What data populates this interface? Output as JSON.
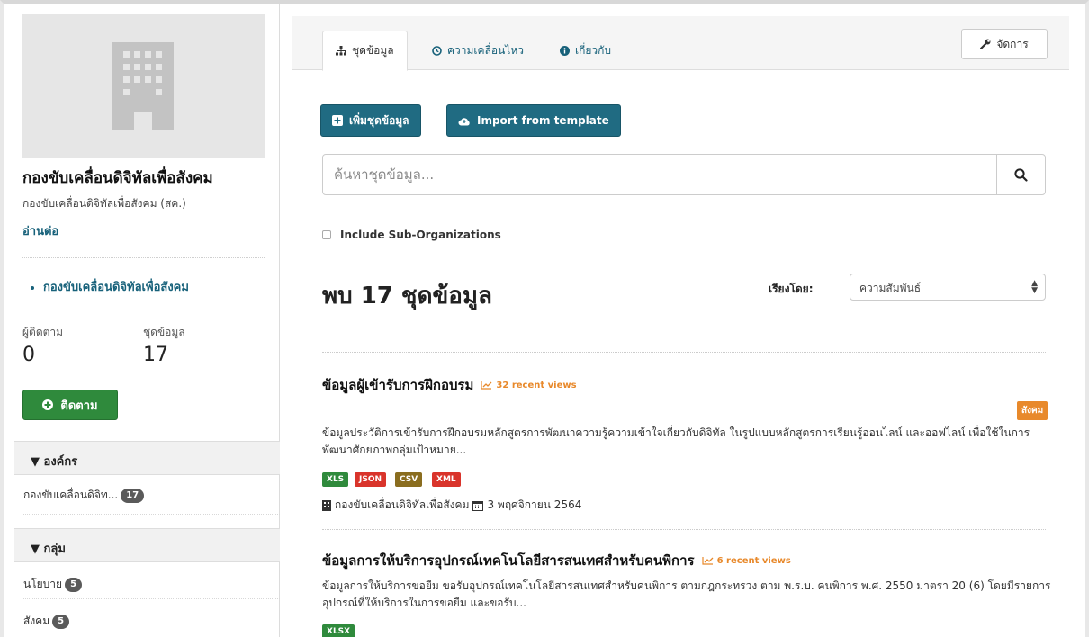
{
  "sidebar": {
    "org_title": "กองขับเคลื่อนดิจิทัลเพื่อสังคม",
    "org_subtitle": "กองขับเคลื่อนดิจิทัลเพื่อสังคม (สค.)",
    "read_more": "อ่านต่อ",
    "org_link": "กองขับเคลื่อนดิจิทัลเพื่อสังคม",
    "followers_label": "ผู้ติดตาม",
    "followers_value": "0",
    "datasets_label": "ชุดข้อมูล",
    "datasets_value": "17",
    "follow_button": "ติดตาม",
    "facets": {
      "org_heading": "องค์กร",
      "org_items": [
        {
          "label": "กองขับเคลื่อนดิจิท...",
          "count": "17"
        }
      ],
      "group_heading": "กลุ่ม",
      "group_items": [
        {
          "label": "นโยบาย",
          "count": "5"
        },
        {
          "label": "สังคม",
          "count": "5"
        }
      ]
    }
  },
  "main": {
    "tabs": [
      {
        "label": "ชุดข้อมูล",
        "icon": "sitemap-icon"
      },
      {
        "label": "ความเคลื่อนไหว",
        "icon": "clock-icon"
      },
      {
        "label": "เกี่ยวกับ",
        "icon": "info-icon"
      }
    ],
    "manage_button": "จัดการ",
    "add_dataset_button": "เพิ่มชุดข้อมูล",
    "import_button": "Import from template",
    "search_placeholder": "ค้นหาชุดข้อมูล...",
    "include_sub_orgs": "Include Sub-Organizations",
    "found_text": "พบ 17 ชุดข้อมูล",
    "sort_label": "เรียงโดย:",
    "sort_value": "ความสัมพันธ์",
    "datasets": [
      {
        "title": "ข้อมูลผู้เข้ารับการฝึกอบรม",
        "views": "32 recent views",
        "tag": "สังคม",
        "description": "ข้อมูลประวัติการเข้ารับการฝึกอบรมหลักสูตรการพัฒนาความรู้ความเข้าใจเกี่ยวกับดิจิทัล ในรูปแบบหลักสูตรการเรียนรู้ออนไลน์ และออฟไลน์ เพื่อใช้ในการพัฒนาศักยภาพกลุ่มเป้าหมาย...",
        "formats": [
          "XLS",
          "JSON",
          "CSV",
          "XML"
        ],
        "org": "กองขับเคลื่อนดิจิทัลเพื่อสังคม",
        "date": "3 พฤศจิกายน 2564"
      },
      {
        "title": "ข้อมูลการให้บริการอุปกรณ์เทคโนโลยีสารสนเทศสำหรับคนพิการ",
        "views": "6 recent views",
        "description": "ข้อมูลการให้บริการขอยืม ขอรับอุปกรณ์เทคโนโลยีสารสนเทศสำหรับคนพิการ ตามกฎกระทรวง ตาม พ.ร.บ. คนพิการ พ.ศ. 2550 มาตรา 20 (6) โดยมีรายการอุปกรณ์ที่ให้บริการในการขอยืม และขอรับ...",
        "formats": [
          "XLSX"
        ]
      }
    ]
  },
  "colors": {
    "primary": "#206b82",
    "link": "#17617a",
    "follow_green": "#2f8a3c",
    "views_orange": "#e8892b",
    "fmt_xls": "#2f8a3c",
    "fmt_json": "#d9342b",
    "fmt_csv": "#8a6d1f",
    "fmt_xml": "#d9342b"
  }
}
